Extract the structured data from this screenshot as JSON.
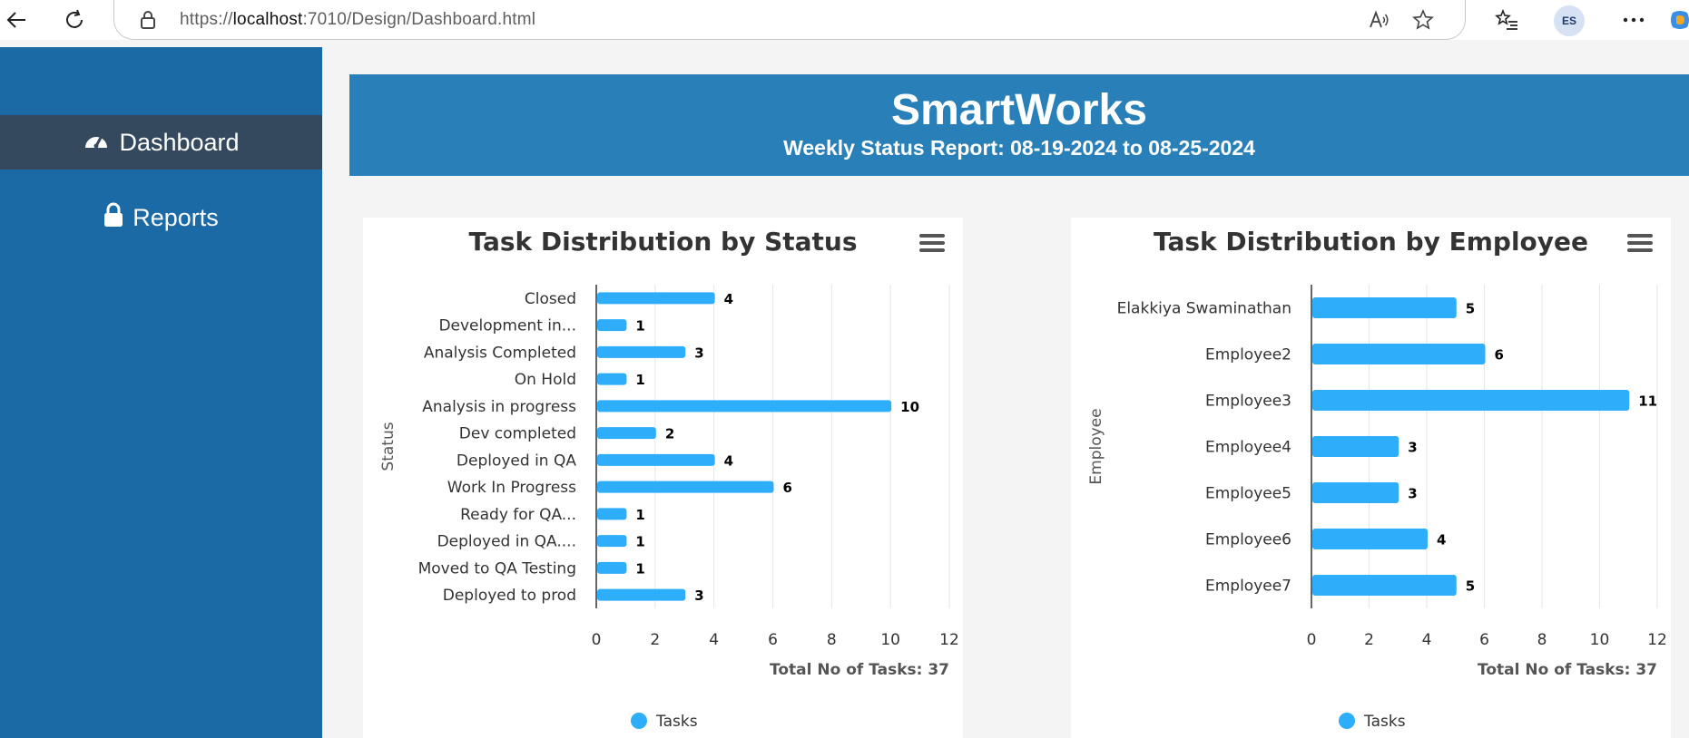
{
  "browser": {
    "url_prefix": "https://",
    "url_host": "localhost",
    "url_rest": ":7010/Design/Dashboard.html",
    "avatar_initials": "ES"
  },
  "sidebar": {
    "items": [
      {
        "label": "Dashboard",
        "icon": "gauge-icon",
        "active": true
      },
      {
        "label": "Reports",
        "icon": "lock-icon",
        "active": false
      }
    ]
  },
  "header": {
    "title": "SmartWorks",
    "subtitle": "Weekly Status Report: 08-19-2024 to 08-25-2024"
  },
  "colors": {
    "bar": "#2eaefa",
    "sidebar": "#1b6aa5",
    "banner": "#2980b9",
    "active_item": "#34495e"
  },
  "chart_data": [
    {
      "type": "bar",
      "orientation": "horizontal",
      "title": "Task Distribution by Status",
      "ylabel": "Status",
      "xlabel": "Total No of Tasks: 37",
      "xlim": [
        0,
        12
      ],
      "xticks": [
        0,
        2,
        4,
        6,
        8,
        10,
        12
      ],
      "grid": true,
      "legend": "bottom",
      "categories": [
        "Closed",
        "Development in...",
        "Analysis Completed",
        "On Hold",
        "Analysis in progress",
        "Dev completed",
        "Deployed in QA",
        "Work In Progress",
        "Ready for QA...",
        "Deployed in QA....",
        "Moved to QA Testing",
        "Deployed to prod"
      ],
      "series": [
        {
          "name": "Tasks",
          "values": [
            4,
            1,
            3,
            1,
            10,
            2,
            4,
            6,
            1,
            1,
            1,
            3
          ]
        }
      ]
    },
    {
      "type": "bar",
      "orientation": "horizontal",
      "title": "Task Distribution by Employee",
      "ylabel": "Employee",
      "xlabel": "Total No of Tasks: 37",
      "xlim": [
        0,
        12
      ],
      "xticks": [
        0,
        2,
        4,
        6,
        8,
        10,
        12
      ],
      "grid": true,
      "legend": "bottom",
      "categories": [
        "Elakkiya Swaminathan",
        "Employee2",
        "Employee3",
        "Employee4",
        "Employee5",
        "Employee6",
        "Employee7"
      ],
      "series": [
        {
          "name": "Tasks",
          "values": [
            5,
            6,
            11,
            3,
            3,
            4,
            5
          ]
        }
      ]
    }
  ]
}
